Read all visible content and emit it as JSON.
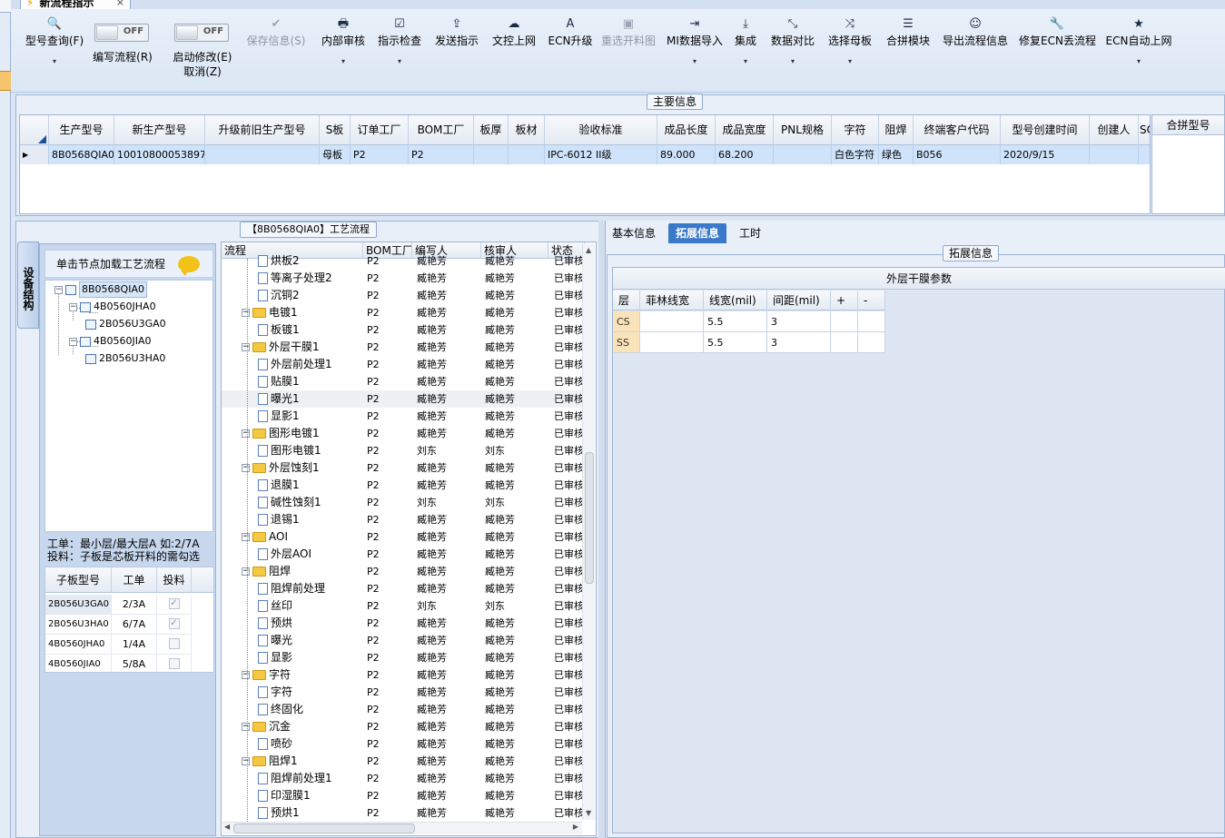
{
  "tab": {
    "title": "新流程指示",
    "close": "×"
  },
  "toolbar": {
    "buttons": [
      {
        "id": "query",
        "label": "型号查询(F)",
        "icon": "🔍",
        "arrow": "▾"
      },
      {
        "id": "save",
        "label": "保存信息(S)",
        "icon": "✔"
      },
      {
        "id": "review",
        "label": "内部审核",
        "icon": "🖶",
        "arrow": "▾"
      },
      {
        "id": "check",
        "label": "指示检查",
        "icon": "☑",
        "arrow": "▾"
      },
      {
        "id": "send",
        "label": "发送指示",
        "icon": "⇪"
      },
      {
        "id": "upload",
        "label": "文控上网",
        "icon": "☁"
      },
      {
        "id": "ecn",
        "label": "ECN升级",
        "icon": "A"
      },
      {
        "id": "cutmap",
        "label": "重选开料图",
        "icon": "▣"
      },
      {
        "id": "mi",
        "label": "MI数据导入",
        "icon": "⇥",
        "arrow": "▾"
      },
      {
        "id": "integrate",
        "label": "集成",
        "icon": "⤓",
        "arrow": "▾"
      },
      {
        "id": "compare",
        "label": "数据对比",
        "icon": "⤡",
        "arrow": "▾"
      },
      {
        "id": "mother",
        "label": "选择母板",
        "icon": "⤨",
        "arrow": "▾"
      },
      {
        "id": "merge",
        "label": "合拼模块",
        "icon": "☰"
      },
      {
        "id": "export",
        "label": "导出流程信息",
        "icon": "☺"
      },
      {
        "id": "fix",
        "label": "修复ECN丢流程",
        "icon": "🔧"
      },
      {
        "id": "autoup",
        "label": "ECN自动上网",
        "icon": "★",
        "arrow": "▾"
      }
    ],
    "toggles": [
      {
        "id": "write",
        "state": "OFF",
        "label": "编写流程(R)"
      },
      {
        "id": "modify",
        "state": "OFF",
        "label": "启动修改(E)",
        "label2": "取消(Z)"
      }
    ]
  },
  "main_info": {
    "title": "主要信息",
    "columns": [
      "生产型号",
      "新生产型号",
      "升级前旧生产型号",
      "S板",
      "订单工厂",
      "BOM工厂",
      "板厚",
      "板材",
      "验收标准",
      "成品长度",
      "成品宽度",
      "PNL规格",
      "字符",
      "阻焊",
      "终端客户代码",
      "型号创建时间",
      "创建人",
      "SO"
    ],
    "row": [
      "8B0568QIA0",
      "10010800053897",
      "",
      "母板",
      "P2",
      "P2",
      "",
      "",
      "IPC-6012 II级",
      "89.000",
      "68.200",
      "",
      "白色字符",
      "绿色",
      "B056",
      "2020/9/15",
      "",
      ""
    ],
    "merge_header": "合拼型号"
  },
  "structure": {
    "vtab": "设备结构",
    "hint": "单击节点加载工艺流程",
    "tree": [
      {
        "label": "8B0568QIA0",
        "level": 0
      },
      {
        "label": "4B0560JHA0",
        "level": 1
      },
      {
        "label": "2B056U3GA0",
        "level": 2
      },
      {
        "label": "4B0560JIA0",
        "level": 1
      },
      {
        "label": "2B056U3HA0",
        "level": 2
      }
    ],
    "note1": "工单：最小层/最大层A 如:2/7A",
    "note2": "投料：子板是芯板开料的需勾选",
    "sub_columns": [
      "子板型号",
      "工单",
      "投料"
    ],
    "sub_rows": [
      {
        "model": "2B056U3GA0",
        "order": "2/3A",
        "feed": true
      },
      {
        "model": "2B056U3HA0",
        "order": "6/7A",
        "feed": true
      },
      {
        "model": "4B0560JHA0",
        "order": "1/4A",
        "feed": false
      },
      {
        "model": "4B0560JIA0",
        "order": "5/8A",
        "feed": false
      }
    ]
  },
  "flow": {
    "title": "【8B0568QIA0】工艺流程",
    "columns": [
      "流程",
      "BOM工厂",
      "编写人",
      "核审人",
      "状态"
    ],
    "rows": [
      {
        "name": "烘板2",
        "type": "file",
        "factory": "P2",
        "writer": "臧艳芳",
        "reviewer": "臧艳芳",
        "status": "已审核"
      },
      {
        "name": "等离子处理2",
        "type": "file",
        "factory": "P2",
        "writer": "臧艳芳",
        "reviewer": "臧艳芳",
        "status": "已审核"
      },
      {
        "name": "沉铜2",
        "type": "file",
        "factory": "P2",
        "writer": "臧艳芳",
        "reviewer": "臧艳芳",
        "status": "已审核"
      },
      {
        "name": "电镀1",
        "type": "folder",
        "factory": "P2",
        "writer": "臧艳芳",
        "reviewer": "臧艳芳",
        "status": "已审核"
      },
      {
        "name": "板镀1",
        "type": "file",
        "factory": "P2",
        "writer": "臧艳芳",
        "reviewer": "臧艳芳",
        "status": "已审核"
      },
      {
        "name": "外层干膜1",
        "type": "folder",
        "factory": "P2",
        "writer": "臧艳芳",
        "reviewer": "臧艳芳",
        "status": "已审核"
      },
      {
        "name": "外层前处理1",
        "type": "file",
        "factory": "P2",
        "writer": "臧艳芳",
        "reviewer": "臧艳芳",
        "status": "已审核"
      },
      {
        "name": "贴膜1",
        "type": "file",
        "factory": "P2",
        "writer": "臧艳芳",
        "reviewer": "臧艳芳",
        "status": "已审核"
      },
      {
        "name": "曝光1",
        "type": "file",
        "factory": "P2",
        "writer": "臧艳芳",
        "reviewer": "臧艳芳",
        "status": "已审核",
        "highlight": true
      },
      {
        "name": "显影1",
        "type": "file",
        "factory": "P2",
        "writer": "臧艳芳",
        "reviewer": "臧艳芳",
        "status": "已审核"
      },
      {
        "name": "图形电镀1",
        "type": "folder",
        "factory": "P2",
        "writer": "臧艳芳",
        "reviewer": "臧艳芳",
        "status": "已审核"
      },
      {
        "name": "图形电镀1",
        "type": "file",
        "factory": "P2",
        "writer": "刘东",
        "reviewer": "刘东",
        "status": "已审核"
      },
      {
        "name": "外层蚀刻1",
        "type": "folder",
        "factory": "P2",
        "writer": "臧艳芳",
        "reviewer": "臧艳芳",
        "status": "已审核"
      },
      {
        "name": "退膜1",
        "type": "file",
        "factory": "P2",
        "writer": "臧艳芳",
        "reviewer": "臧艳芳",
        "status": "已审核"
      },
      {
        "name": "碱性蚀刻1",
        "type": "file",
        "factory": "P2",
        "writer": "刘东",
        "reviewer": "刘东",
        "status": "已审核"
      },
      {
        "name": "退锡1",
        "type": "file",
        "factory": "P2",
        "writer": "臧艳芳",
        "reviewer": "臧艳芳",
        "status": "已审核"
      },
      {
        "name": "AOI",
        "type": "folder",
        "factory": "P2",
        "writer": "臧艳芳",
        "reviewer": "臧艳芳",
        "status": "已审核"
      },
      {
        "name": "外层AOI",
        "type": "file",
        "factory": "P2",
        "writer": "臧艳芳",
        "reviewer": "臧艳芳",
        "status": "已审核"
      },
      {
        "name": "阻焊",
        "type": "folder",
        "factory": "P2",
        "writer": "臧艳芳",
        "reviewer": "臧艳芳",
        "status": "已审核"
      },
      {
        "name": "阻焊前处理",
        "type": "file",
        "factory": "P2",
        "writer": "臧艳芳",
        "reviewer": "臧艳芳",
        "status": "已审核"
      },
      {
        "name": "丝印",
        "type": "file",
        "factory": "P2",
        "writer": "刘东",
        "reviewer": "刘东",
        "status": "已审核"
      },
      {
        "name": "预烘",
        "type": "file",
        "factory": "P2",
        "writer": "臧艳芳",
        "reviewer": "臧艳芳",
        "status": "已审核"
      },
      {
        "name": "曝光",
        "type": "file",
        "factory": "P2",
        "writer": "臧艳芳",
        "reviewer": "臧艳芳",
        "status": "已审核"
      },
      {
        "name": "显影",
        "type": "file",
        "factory": "P2",
        "writer": "臧艳芳",
        "reviewer": "臧艳芳",
        "status": "已审核"
      },
      {
        "name": "字符",
        "type": "folder",
        "factory": "P2",
        "writer": "臧艳芳",
        "reviewer": "臧艳芳",
        "status": "已审核"
      },
      {
        "name": "字符",
        "type": "file",
        "factory": "P2",
        "writer": "臧艳芳",
        "reviewer": "臧艳芳",
        "status": "已审核"
      },
      {
        "name": "终固化",
        "type": "file",
        "factory": "P2",
        "writer": "臧艳芳",
        "reviewer": "臧艳芳",
        "status": "已审核"
      },
      {
        "name": "沉金",
        "type": "folder",
        "factory": "P2",
        "writer": "臧艳芳",
        "reviewer": "臧艳芳",
        "status": "已审核"
      },
      {
        "name": "喷砂",
        "type": "file",
        "factory": "P2",
        "writer": "臧艳芳",
        "reviewer": "臧艳芳",
        "status": "已审核"
      },
      {
        "name": "阻焊1",
        "type": "folder",
        "factory": "P2",
        "writer": "臧艳芳",
        "reviewer": "臧艳芳",
        "status": "已审核"
      },
      {
        "name": "阻焊前处理1",
        "type": "file",
        "factory": "P2",
        "writer": "臧艳芳",
        "reviewer": "臧艳芳",
        "status": "已审核"
      },
      {
        "name": "印湿膜1",
        "type": "file",
        "factory": "P2",
        "writer": "臧艳芳",
        "reviewer": "臧艳芳",
        "status": "已审核"
      },
      {
        "name": "预烘1",
        "type": "file",
        "factory": "P2",
        "writer": "臧艳芳",
        "reviewer": "臧艳芳",
        "status": "已审核"
      }
    ]
  },
  "right": {
    "tabs": [
      {
        "label": "基本信息",
        "active": false
      },
      {
        "label": "拓展信息",
        "active": true
      },
      {
        "label": "工时",
        "active": false
      }
    ],
    "group_title": "拓展信息",
    "grid_title": "外层干膜参数",
    "columns": [
      "层",
      "菲林线宽",
      "线宽(mil)",
      "间距(mil)",
      "+",
      "-"
    ],
    "rows": [
      {
        "layer": "CS",
        "film": "",
        "width": "5.5",
        "spacing": "3"
      },
      {
        "layer": "SS",
        "film": "",
        "width": "5.5",
        "spacing": "3"
      }
    ]
  }
}
